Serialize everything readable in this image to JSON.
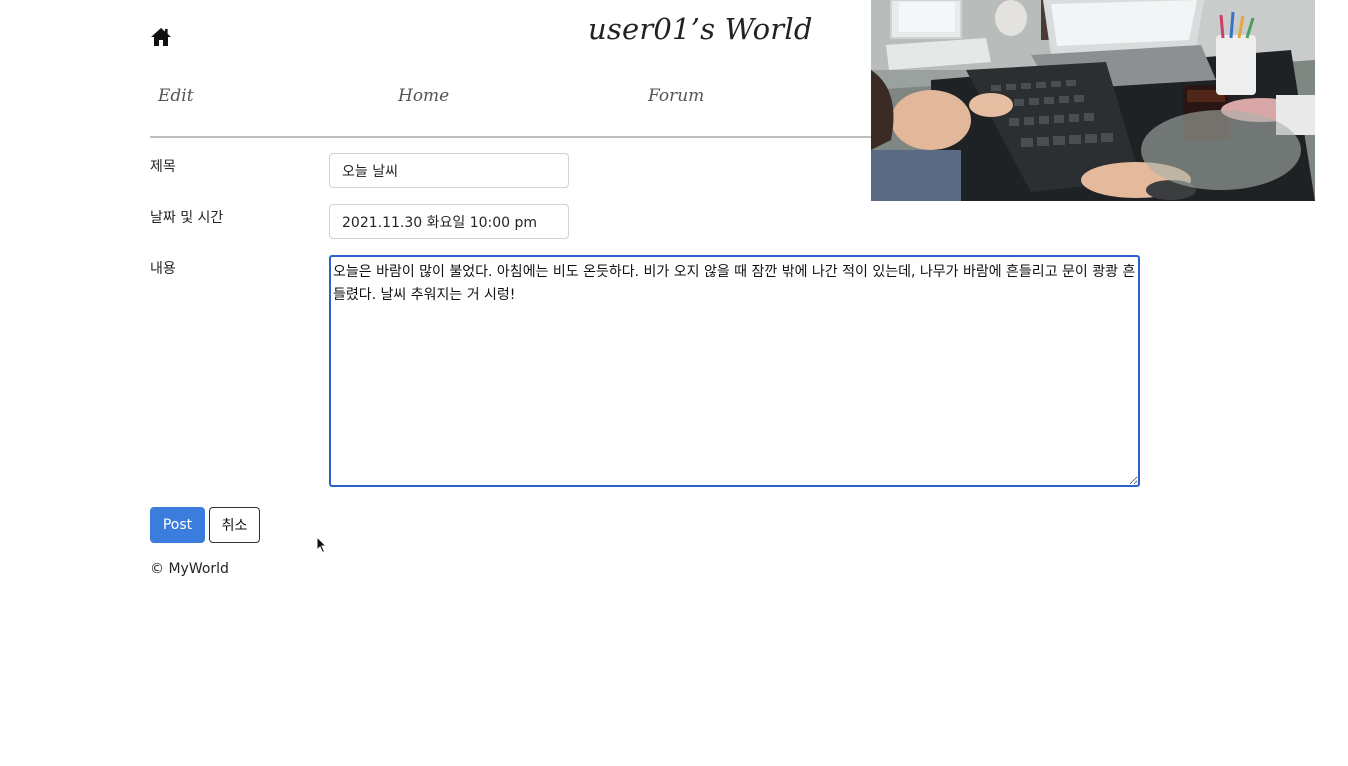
{
  "header": {
    "home_icon": "home-icon",
    "title": "user01’s World"
  },
  "nav": {
    "edit": "Edit",
    "home": "Home",
    "forum": "Forum"
  },
  "form": {
    "title_label": "제목",
    "title_value": "오늘 날씨",
    "datetime_label": "날짜 및 시간",
    "datetime_value": "2021.11.30 화요일 10:00 pm",
    "content_label": "내용",
    "content_value": "오늘은 바람이 많이 불었다. 아침에는 비도 온듯하다. 비가 오지 않을 때 잠깐 밖에 나간 적이 있는데, 나무가 바람에 흔들리고 문이 쾅쾅 흔들렸다. 날씨 추워지는 거 시렁!"
  },
  "actions": {
    "post_label": "Post",
    "cancel_label": "취소"
  },
  "footer": {
    "copyright": "© MyWorld"
  },
  "colors": {
    "primary": "#3b7ddd",
    "focus_border": "#2b63c8"
  }
}
